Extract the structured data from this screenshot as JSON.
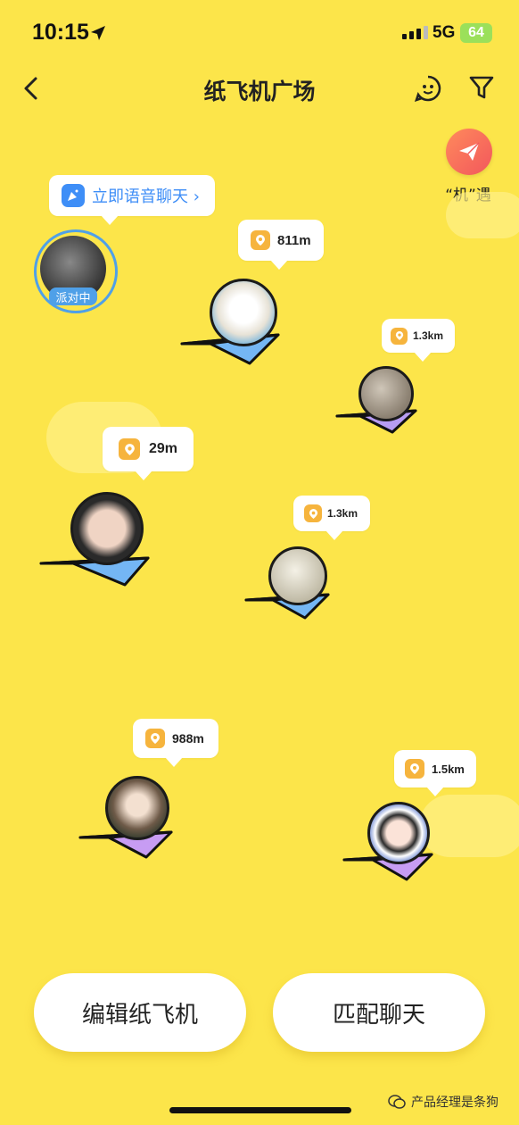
{
  "status_bar": {
    "time": "10:15",
    "network": "5G",
    "battery": "64"
  },
  "nav": {
    "title": "纸飞机广场"
  },
  "encounter": {
    "label": "“机”遇"
  },
  "voice_chat": {
    "label": "立即语音聊天 ›"
  },
  "party": {
    "badge": "派对中"
  },
  "planes": [
    {
      "distance": "811m",
      "color": "#74B6F4"
    },
    {
      "distance": "1.3km",
      "color": "#B79CF3"
    },
    {
      "distance": "29m",
      "color": "#74B6F4"
    },
    {
      "distance": "1.3km",
      "color": "#74B6F4"
    },
    {
      "distance": "988m",
      "color": "#C79CF3"
    },
    {
      "distance": "1.5km",
      "color": "#C79CF3"
    }
  ],
  "actions": {
    "edit": "编辑纸飞机",
    "match": "匹配聊天"
  },
  "watermark": {
    "text": "产品经理是条狗"
  }
}
